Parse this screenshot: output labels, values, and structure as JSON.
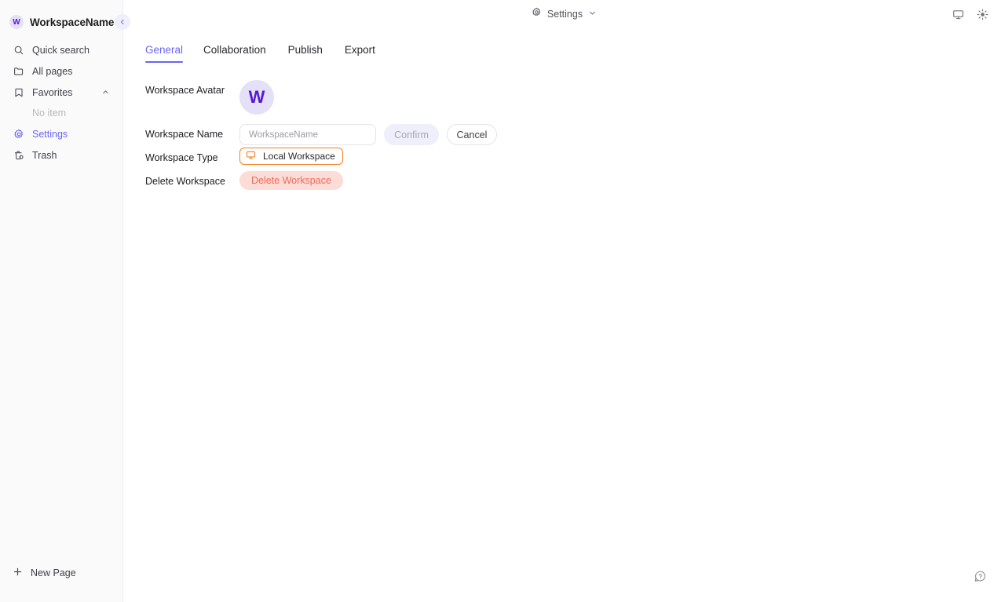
{
  "sidebar": {
    "workspace": {
      "avatar_letter": "W",
      "name": "WorkspaceName"
    },
    "collapse_icon": "chevron-left-icon",
    "items": [
      {
        "label": "Quick search",
        "icon": "search-icon",
        "active": false
      },
      {
        "label": "All pages",
        "icon": "folder-icon",
        "active": false
      },
      {
        "label": "Favorites",
        "icon": "bookmark-icon",
        "active": false,
        "chevron": "chevron-up-icon"
      },
      {
        "label": "Settings",
        "icon": "gear-icon",
        "active": true
      },
      {
        "label": "Trash",
        "icon": "trash-icon",
        "active": false
      }
    ],
    "favorites_empty": "No item",
    "new_page": {
      "label": "New Page",
      "icon": "plus-icon"
    }
  },
  "topbar": {
    "breadcrumb_label": "Settings",
    "breadcrumb_icon": "gear-icon",
    "breadcrumb_chevron": "chevron-down-icon",
    "right_icons": [
      {
        "name": "display-icon"
      },
      {
        "name": "brightness-icon"
      }
    ]
  },
  "tabs": [
    {
      "label": "General",
      "active": true
    },
    {
      "label": "Collaboration",
      "active": false
    },
    {
      "label": "Publish",
      "active": false
    },
    {
      "label": "Export",
      "active": false
    }
  ],
  "general": {
    "avatar": {
      "label": "Workspace Avatar",
      "letter": "W"
    },
    "name": {
      "label": "Workspace Name",
      "value": "",
      "placeholder": "WorkspaceName",
      "confirm_label": "Confirm",
      "cancel_label": "Cancel"
    },
    "type": {
      "label": "Workspace Type",
      "badge_label": "Local Workspace",
      "badge_icon": "display-icon"
    },
    "delete": {
      "label": "Delete Workspace",
      "button_label": "Delete Workspace"
    }
  },
  "help": {
    "icon": "help-icon"
  },
  "colors": {
    "accent": "#6a65f1",
    "avatar_bg": "#e3e0f7",
    "avatar_fg": "#5518d4",
    "type_border": "#f5811f",
    "delete_bg": "#fbdcd6",
    "delete_fg": "#ef6c5a",
    "sidebar_bg": "#fafafa"
  }
}
